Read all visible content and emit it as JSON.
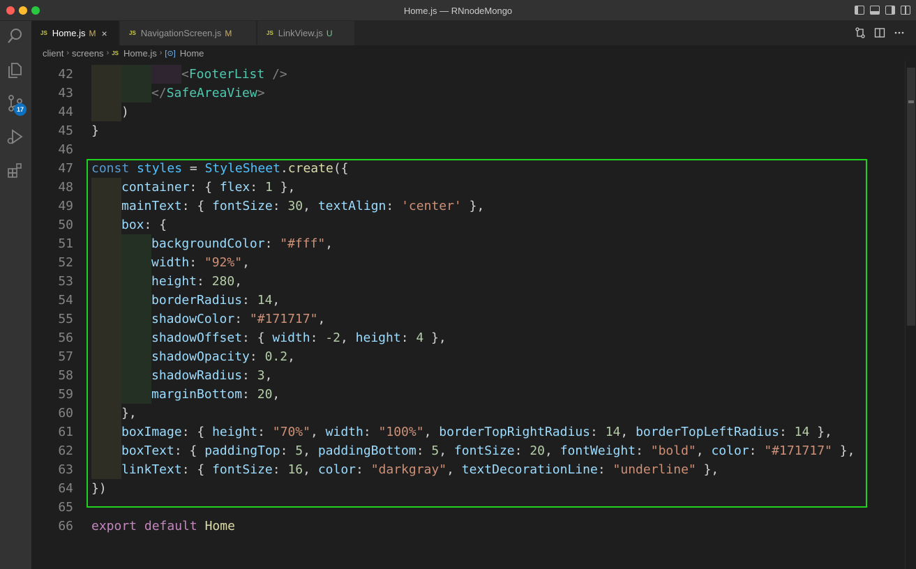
{
  "window": {
    "title": "Home.js — RNnodeMongo"
  },
  "activity_bar": {
    "scm_badge": "17",
    "items": [
      "search-icon",
      "explorer-icon",
      "source-control-icon",
      "run-debug-icon",
      "extensions-icon"
    ]
  },
  "tabs": [
    {
      "icon": "JS",
      "label": "Home.js",
      "status": "M",
      "close": "×",
      "active": true
    },
    {
      "icon": "JS",
      "label": "NavigationScreen.js",
      "status": "M",
      "active": false
    },
    {
      "icon": "JS",
      "label": "LinkView.js",
      "status": "U",
      "active": false
    }
  ],
  "breadcrumb": {
    "parts": [
      "client",
      "screens",
      "Home.js",
      "Home"
    ],
    "file_icon": "JS",
    "separator": "›"
  },
  "editor": {
    "lines": [
      {
        "n": "42",
        "tokens": [
          [
            "tk-ang",
            "<"
          ],
          [
            "tk-tag",
            "FooterList"
          ],
          [
            "tk-pl",
            " "
          ],
          [
            "tk-ang",
            "/>"
          ]
        ]
      },
      {
        "n": "43",
        "tokens": [
          [
            "tk-ang",
            "</"
          ],
          [
            "tk-tag",
            "SafeAreaView"
          ],
          [
            "tk-ang",
            ">"
          ]
        ]
      },
      {
        "n": "44",
        "tokens": [
          [
            "tk-pl",
            ")"
          ]
        ]
      },
      {
        "n": "45",
        "tokens": [
          [
            "tk-pl",
            "}"
          ]
        ]
      },
      {
        "n": "46",
        "tokens": []
      },
      {
        "n": "47",
        "tokens": [
          [
            "tk-kw",
            "const"
          ],
          [
            "tk-pl",
            " "
          ],
          [
            "tk-var",
            "styles"
          ],
          [
            "tk-pl",
            " = "
          ],
          [
            "tk-var",
            "StyleSheet"
          ],
          [
            "tk-pl",
            "."
          ],
          [
            "tk-fn",
            "create"
          ],
          [
            "tk-pl",
            "({"
          ]
        ]
      },
      {
        "n": "48",
        "tokens": [
          [
            "tk-prop",
            "container"
          ],
          [
            "tk-pl",
            ": { "
          ],
          [
            "tk-prop",
            "flex"
          ],
          [
            "tk-pl",
            ": "
          ],
          [
            "tk-num",
            "1"
          ],
          [
            "tk-pl",
            " },"
          ]
        ]
      },
      {
        "n": "49",
        "tokens": [
          [
            "tk-prop",
            "mainText"
          ],
          [
            "tk-pl",
            ": { "
          ],
          [
            "tk-prop",
            "fontSize"
          ],
          [
            "tk-pl",
            ": "
          ],
          [
            "tk-num",
            "30"
          ],
          [
            "tk-pl",
            ", "
          ],
          [
            "tk-prop",
            "textAlign"
          ],
          [
            "tk-pl",
            ": "
          ],
          [
            "tk-str",
            "'center'"
          ],
          [
            "tk-pl",
            " },"
          ]
        ]
      },
      {
        "n": "50",
        "tokens": [
          [
            "tk-prop",
            "box"
          ],
          [
            "tk-pl",
            ": {"
          ]
        ]
      },
      {
        "n": "51",
        "tokens": [
          [
            "tk-prop",
            "backgroundColor"
          ],
          [
            "tk-pl",
            ": "
          ],
          [
            "tk-str",
            "\"#fff\""
          ],
          [
            "tk-pl",
            ","
          ]
        ]
      },
      {
        "n": "52",
        "tokens": [
          [
            "tk-prop",
            "width"
          ],
          [
            "tk-pl",
            ": "
          ],
          [
            "tk-str",
            "\"92%\""
          ],
          [
            "tk-pl",
            ","
          ]
        ]
      },
      {
        "n": "53",
        "tokens": [
          [
            "tk-prop",
            "height"
          ],
          [
            "tk-pl",
            ": "
          ],
          [
            "tk-num",
            "280"
          ],
          [
            "tk-pl",
            ","
          ]
        ]
      },
      {
        "n": "54",
        "tokens": [
          [
            "tk-prop",
            "borderRadius"
          ],
          [
            "tk-pl",
            ": "
          ],
          [
            "tk-num",
            "14"
          ],
          [
            "tk-pl",
            ","
          ]
        ]
      },
      {
        "n": "55",
        "tokens": [
          [
            "tk-prop",
            "shadowColor"
          ],
          [
            "tk-pl",
            ": "
          ],
          [
            "tk-str",
            "\"#171717\""
          ],
          [
            "tk-pl",
            ","
          ]
        ]
      },
      {
        "n": "56",
        "tokens": [
          [
            "tk-prop",
            "shadowOffset"
          ],
          [
            "tk-pl",
            ": { "
          ],
          [
            "tk-prop",
            "width"
          ],
          [
            "tk-pl",
            ": "
          ],
          [
            "tk-num",
            "-2"
          ],
          [
            "tk-pl",
            ", "
          ],
          [
            "tk-prop",
            "height"
          ],
          [
            "tk-pl",
            ": "
          ],
          [
            "tk-num",
            "4"
          ],
          [
            "tk-pl",
            " },"
          ]
        ]
      },
      {
        "n": "57",
        "tokens": [
          [
            "tk-prop",
            "shadowOpacity"
          ],
          [
            "tk-pl",
            ": "
          ],
          [
            "tk-num",
            "0.2"
          ],
          [
            "tk-pl",
            ","
          ]
        ]
      },
      {
        "n": "58",
        "tokens": [
          [
            "tk-prop",
            "shadowRadius"
          ],
          [
            "tk-pl",
            ": "
          ],
          [
            "tk-num",
            "3"
          ],
          [
            "tk-pl",
            ","
          ]
        ]
      },
      {
        "n": "59",
        "tokens": [
          [
            "tk-prop",
            "marginBottom"
          ],
          [
            "tk-pl",
            ": "
          ],
          [
            "tk-num",
            "20"
          ],
          [
            "tk-pl",
            ","
          ]
        ]
      },
      {
        "n": "60",
        "tokens": [
          [
            "tk-pl",
            "},"
          ]
        ]
      },
      {
        "n": "61",
        "tokens": [
          [
            "tk-prop",
            "boxImage"
          ],
          [
            "tk-pl",
            ": { "
          ],
          [
            "tk-prop",
            "height"
          ],
          [
            "tk-pl",
            ": "
          ],
          [
            "tk-str",
            "\"70%\""
          ],
          [
            "tk-pl",
            ", "
          ],
          [
            "tk-prop",
            "width"
          ],
          [
            "tk-pl",
            ": "
          ],
          [
            "tk-str",
            "\"100%\""
          ],
          [
            "tk-pl",
            ", "
          ],
          [
            "tk-prop",
            "borderTopRightRadius"
          ],
          [
            "tk-pl",
            ": "
          ],
          [
            "tk-num",
            "14"
          ],
          [
            "tk-pl",
            ", "
          ],
          [
            "tk-prop",
            "borderTopLeftRadius"
          ],
          [
            "tk-pl",
            ": "
          ],
          [
            "tk-num",
            "14"
          ],
          [
            "tk-pl",
            " },"
          ]
        ]
      },
      {
        "n": "62",
        "tokens": [
          [
            "tk-prop",
            "boxText"
          ],
          [
            "tk-pl",
            ": { "
          ],
          [
            "tk-prop",
            "paddingTop"
          ],
          [
            "tk-pl",
            ": "
          ],
          [
            "tk-num",
            "5"
          ],
          [
            "tk-pl",
            ", "
          ],
          [
            "tk-prop",
            "paddingBottom"
          ],
          [
            "tk-pl",
            ": "
          ],
          [
            "tk-num",
            "5"
          ],
          [
            "tk-pl",
            ", "
          ],
          [
            "tk-prop",
            "fontSize"
          ],
          [
            "tk-pl",
            ": "
          ],
          [
            "tk-num",
            "20"
          ],
          [
            "tk-pl",
            ", "
          ],
          [
            "tk-prop",
            "fontWeight"
          ],
          [
            "tk-pl",
            ": "
          ],
          [
            "tk-str",
            "\"bold\""
          ],
          [
            "tk-pl",
            ", "
          ],
          [
            "tk-prop",
            "color"
          ],
          [
            "tk-pl",
            ": "
          ],
          [
            "tk-str",
            "\"#171717\""
          ],
          [
            "tk-pl",
            " },"
          ]
        ]
      },
      {
        "n": "63",
        "tokens": [
          [
            "tk-prop",
            "linkText"
          ],
          [
            "tk-pl",
            ": { "
          ],
          [
            "tk-prop",
            "fontSize"
          ],
          [
            "tk-pl",
            ": "
          ],
          [
            "tk-num",
            "16"
          ],
          [
            "tk-pl",
            ", "
          ],
          [
            "tk-prop",
            "color"
          ],
          [
            "tk-pl",
            ": "
          ],
          [
            "tk-str",
            "\"darkgray\""
          ],
          [
            "tk-pl",
            ", "
          ],
          [
            "tk-prop",
            "textDecorationLine"
          ],
          [
            "tk-pl",
            ": "
          ],
          [
            "tk-str",
            "\"underline\""
          ],
          [
            "tk-pl",
            " },"
          ]
        ]
      },
      {
        "n": "64",
        "tokens": [
          [
            "tk-pl",
            "})"
          ]
        ]
      },
      {
        "n": "65",
        "tokens": []
      },
      {
        "n": "66",
        "tokens": [
          [
            "tk-ctl",
            "export"
          ],
          [
            "tk-pl",
            " "
          ],
          [
            "tk-ctl",
            "default"
          ],
          [
            "tk-pl",
            " "
          ],
          [
            "tk-fn",
            "Home"
          ]
        ]
      }
    ]
  },
  "colors": {
    "highlight_border": "#1fd21f",
    "editor_bg": "#1e1e1e"
  }
}
